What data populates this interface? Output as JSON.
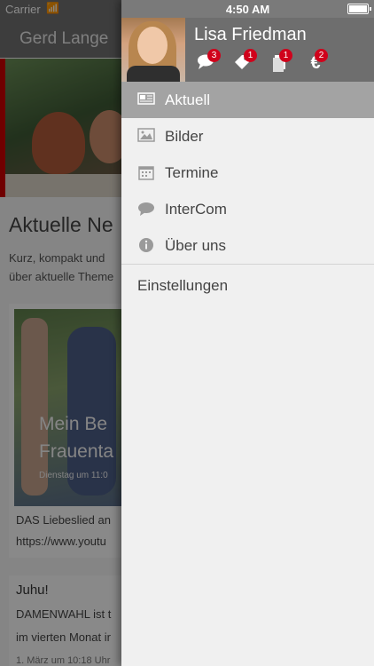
{
  "status_bar": {
    "carrier": "Carrier",
    "time": "4:50 AM"
  },
  "background": {
    "title": "Gerd Lange",
    "heading": "Aktuelle Ne",
    "intro_lines": [
      "Kurz, kompakt und",
      "über aktuelle Theme"
    ],
    "card": {
      "title_lines": [
        "Mein Be",
        "Frauenta"
      ],
      "date": "Dienstag um 11:0",
      "text_lines": [
        "DAS Liebeslied an",
        "https://www.youtu"
      ]
    },
    "card2": {
      "title": "Juhu!",
      "text_lines": [
        "DAMENWAHL ist t",
        "im vierten Monat ir",
        "1. März um 10:18 Uhr"
      ]
    }
  },
  "drawer": {
    "user_name": "Lisa Friedman",
    "header_icons": [
      {
        "icon": "chat-icon",
        "badge": "3"
      },
      {
        "icon": "tag-icon",
        "badge": "1"
      },
      {
        "icon": "document-icon",
        "badge": "1"
      },
      {
        "icon": "euro-icon",
        "badge": "2"
      }
    ],
    "menu": [
      {
        "icon": "newspaper-icon",
        "label": "Aktuell",
        "active": true
      },
      {
        "icon": "image-icon",
        "label": "Bilder",
        "active": false
      },
      {
        "icon": "calendar-icon",
        "label": "Termine",
        "active": false
      },
      {
        "icon": "speech-bubble-icon",
        "label": "InterCom",
        "active": false
      },
      {
        "icon": "info-icon",
        "label": "Über uns",
        "active": false
      }
    ],
    "settings_label": "Einstellungen"
  }
}
